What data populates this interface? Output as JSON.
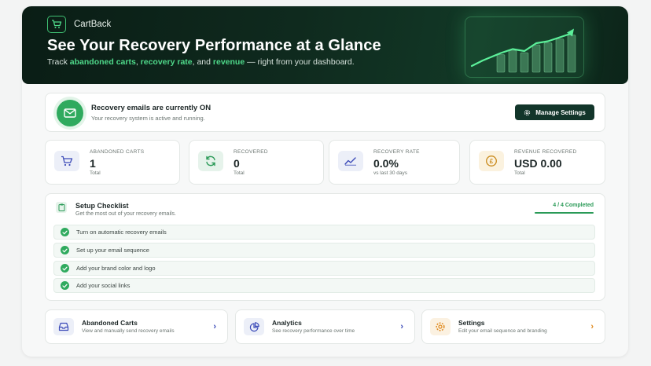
{
  "brand": {
    "name": "CartBack"
  },
  "hero": {
    "title": "See Your Recovery Performance at a Glance",
    "sub_prefix": "Track ",
    "sub_hl1": "abandoned carts",
    "sub_sep1": ", ",
    "sub_hl2": "recovery rate",
    "sub_sep2": ", and ",
    "sub_hl3": "revenue",
    "sub_suffix": " — right from your dashboard.",
    "chart_bars": [
      0.45,
      0.55,
      0.5,
      0.7,
      0.75,
      0.85,
      0.95
    ]
  },
  "status": {
    "title": "Recovery emails are currently ON",
    "subtitle": "Your recovery system is active and running.",
    "button_label": "Manage Settings"
  },
  "stats": [
    {
      "label": "ABANDONED CARTS",
      "value": "1",
      "note": "Total",
      "icon": "cart-icon",
      "color": "#3c4bb8",
      "bg": "#eceff8"
    },
    {
      "label": "RECOVERED",
      "value": "0",
      "note": "Total",
      "icon": "refresh-icon",
      "color": "#2a9a57",
      "bg": "#e6f3eb"
    },
    {
      "label": "RECOVERY RATE",
      "value": "0.0%",
      "note": "vs last 30 days",
      "icon": "trend-icon",
      "color": "#3c4bb8",
      "bg": "#eceff8"
    },
    {
      "label": "REVENUE RECOVERED",
      "value": "USD 0.00",
      "note": "Total",
      "icon": "coin-icon",
      "color": "#c9891a",
      "bg": "#fbf2df"
    }
  ],
  "checklist": {
    "title": "Setup Checklist",
    "subtitle": "Get the most out of your recovery emails.",
    "progress_label": "4 / 4 Completed",
    "progress": 1.0,
    "items": [
      {
        "label": "Turn on automatic recovery emails"
      },
      {
        "label": "Set up your email sequence"
      },
      {
        "label": "Add your brand color and logo"
      },
      {
        "label": "Add your social links"
      }
    ]
  },
  "nav": [
    {
      "title": "Abandoned Carts",
      "subtitle": "View and manually send recovery emails",
      "icon": "inbox-icon",
      "color": "#3c4bb8",
      "bg": "#eceff8"
    },
    {
      "title": "Analytics",
      "subtitle": "See recovery performance over time",
      "icon": "pie-chart-icon",
      "color": "#3c4bb8",
      "bg": "#eceff8"
    },
    {
      "title": "Settings",
      "subtitle": "Edit your email sequence and branding",
      "icon": "gear-icon",
      "color": "#e08a1e",
      "bg": "#fbf1e1"
    }
  ]
}
